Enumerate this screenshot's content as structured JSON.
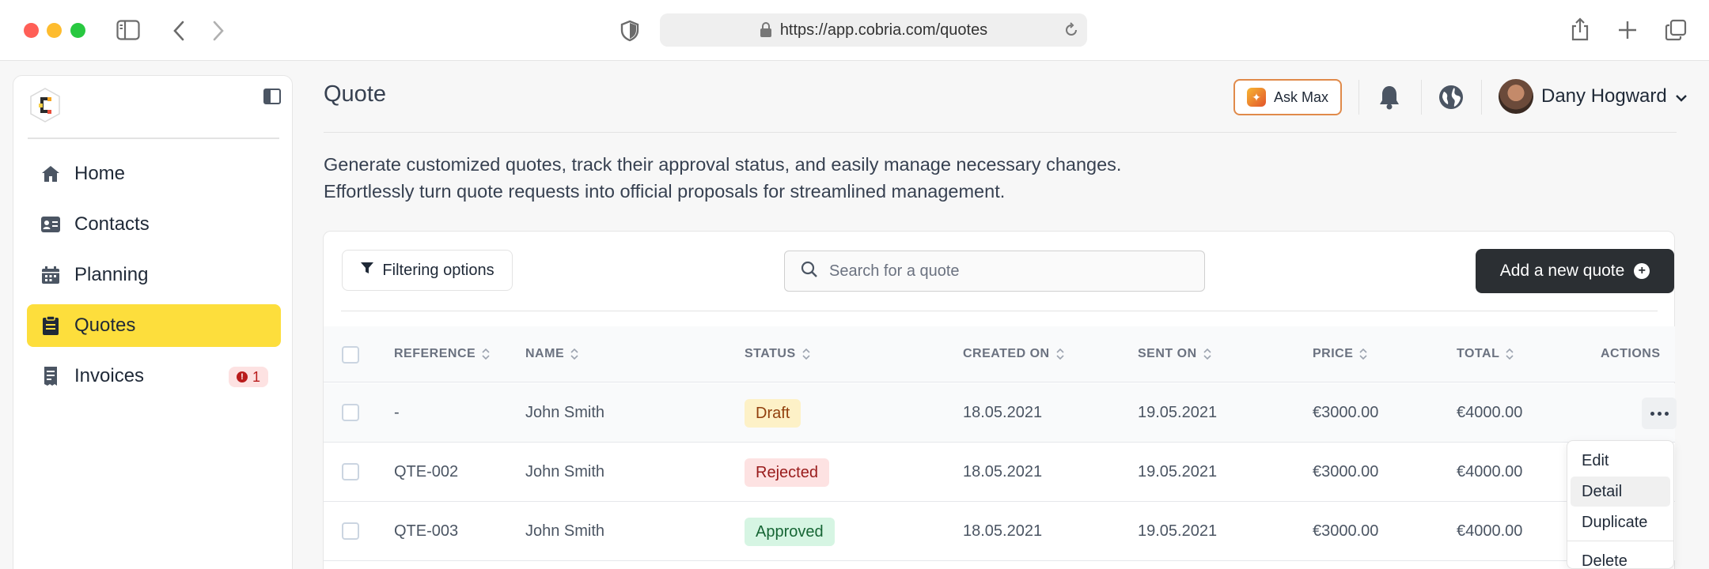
{
  "browser": {
    "url": "https://app.cobria.com/quotes"
  },
  "sidebar": {
    "items": [
      {
        "label": "Home",
        "icon": "home-icon"
      },
      {
        "label": "Contacts",
        "icon": "contact-card-icon"
      },
      {
        "label": "Planning",
        "icon": "calendar-icon"
      },
      {
        "label": "Quotes",
        "icon": "clipboard-icon",
        "active": true
      },
      {
        "label": "Invoices",
        "icon": "invoice-icon",
        "badge": "1"
      }
    ]
  },
  "header": {
    "title": "Quote",
    "ask_max": "Ask Max",
    "user_name": "Dany Hogward"
  },
  "description": {
    "line1": "Generate customized quotes, track their approval status, and easily manage necessary changes.",
    "line2": "Effortlessly turn quote requests into official proposals for streamlined management."
  },
  "toolbar": {
    "filter_label": "Filtering options",
    "search_placeholder": "Search for a quote",
    "add_label": "Add a new quote"
  },
  "table": {
    "columns": [
      "REFERENCE",
      "NAME",
      "STATUS",
      "CREATED ON",
      "SENT ON",
      "PRICE",
      "TOTAL",
      "ACTIONS"
    ],
    "rows": [
      {
        "reference": "-",
        "name": "John Smith",
        "status": "Draft",
        "created": "18.05.2021",
        "sent": "19.05.2021",
        "price": "€3000.00",
        "total": "€4000.00"
      },
      {
        "reference": "QTE-002",
        "name": "John Smith",
        "status": "Rejected",
        "created": "18.05.2021",
        "sent": "19.05.2021",
        "price": "€3000.00",
        "total": "€4000.00"
      },
      {
        "reference": "QTE-003",
        "name": "John Smith",
        "status": "Approved",
        "created": "18.05.2021",
        "sent": "19.05.2021",
        "price": "€3000.00",
        "total": "€4000.00"
      }
    ]
  },
  "actions_menu": {
    "items": [
      "Edit",
      "Detail",
      "Duplicate",
      "Delete"
    ]
  },
  "colors": {
    "accent_yellow": "#fdde3c",
    "primary_dark": "#2b2f33"
  }
}
